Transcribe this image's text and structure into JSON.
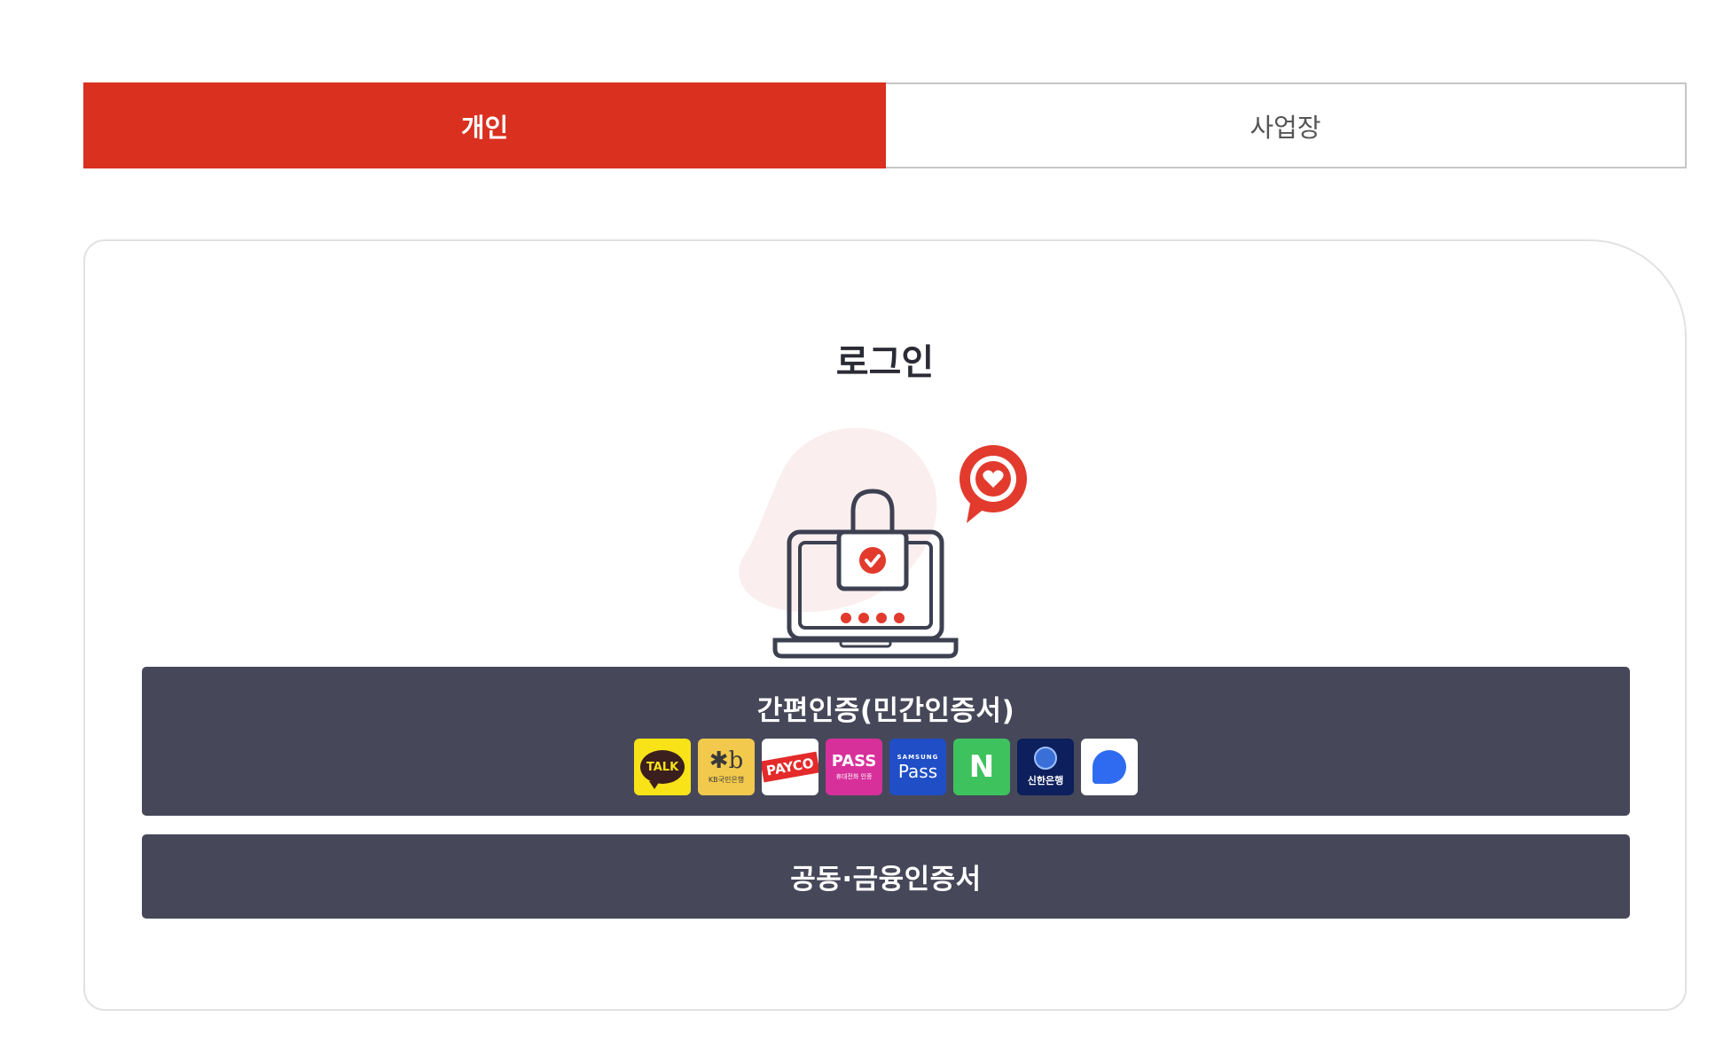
{
  "tabs": [
    {
      "label": "개인",
      "active": true
    },
    {
      "label": "사업장",
      "active": false
    }
  ],
  "card": {
    "title": "로그인"
  },
  "auth": {
    "simple": {
      "label": "간편인증(민간인증서)",
      "providers": [
        {
          "name": "kakao",
          "text": "TALK"
        },
        {
          "name": "kb",
          "text": "KB국민은행"
        },
        {
          "name": "payco",
          "text": "PAYCO"
        },
        {
          "name": "pass",
          "text": "PASS",
          "sub": "휴대전화 인증"
        },
        {
          "name": "samsung-pass",
          "top": "SAMSUNG",
          "text": "Pass"
        },
        {
          "name": "naver",
          "text": "N"
        },
        {
          "name": "shinhan",
          "text": "신한은행"
        },
        {
          "name": "toss",
          "text": ""
        }
      ]
    },
    "certificate": {
      "label": "공동·금융인증서"
    }
  },
  "colors": {
    "accent": "#d93020",
    "button_bg": "#464859",
    "tab_border": "#c6c6c6"
  }
}
